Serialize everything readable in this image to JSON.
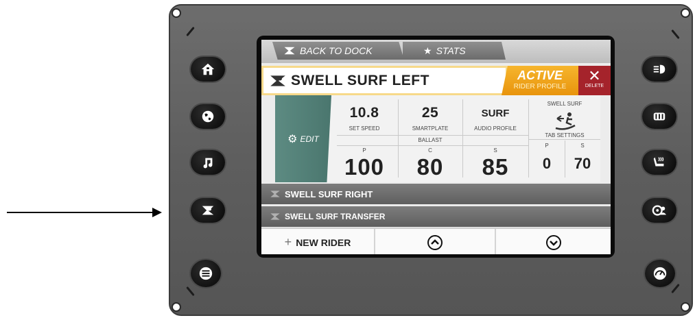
{
  "header_tabs": [
    {
      "label": "BACK TO DOCK",
      "icon": "rider-icon"
    },
    {
      "label": "STATS",
      "icon": "star-icon"
    }
  ],
  "profile": {
    "name": "SWELL SURF LEFT",
    "status_title": "ACTIVE",
    "status_sub": "RIDER PROFILE",
    "delete_label": "DELETE"
  },
  "details": {
    "edit_label": "EDIT",
    "set_speed": {
      "value": "10.8",
      "label": "SET SPEED"
    },
    "smartplate": {
      "value": "25",
      "label": "SMARTPLATE"
    },
    "audio_profile": {
      "value": "SURF",
      "label": "AUDIO PROFILE"
    },
    "wave_label": "SWELL SURF",
    "ballast": {
      "label": "BALLAST",
      "p_label": "P",
      "p_value": "100",
      "c_label": "C",
      "c_value": "80",
      "s_label": "S",
      "s_value": "85"
    },
    "tab_settings": {
      "label": "TAB SETTINGS",
      "p_label": "P",
      "p_value": "0",
      "s_label": "S",
      "s_value": "70"
    }
  },
  "riders": [
    "SWELL SURF RIGHT",
    "SWELL SURF TRANSFER"
  ],
  "bottom": {
    "new_rider_label": "NEW RIDER"
  },
  "left_buttons": [
    "home-icon",
    "globe-icon",
    "music-icon",
    "rider-icon",
    "menu-icon"
  ],
  "right_buttons": [
    "headlight-icon",
    "light-bank-icon",
    "heated-seat-icon",
    "driver-profile-icon",
    "speedometer-icon"
  ],
  "colors": {
    "active_orange": "#f0a11f",
    "delete_red": "#a5232b",
    "edit_teal": "#5d8b82"
  }
}
